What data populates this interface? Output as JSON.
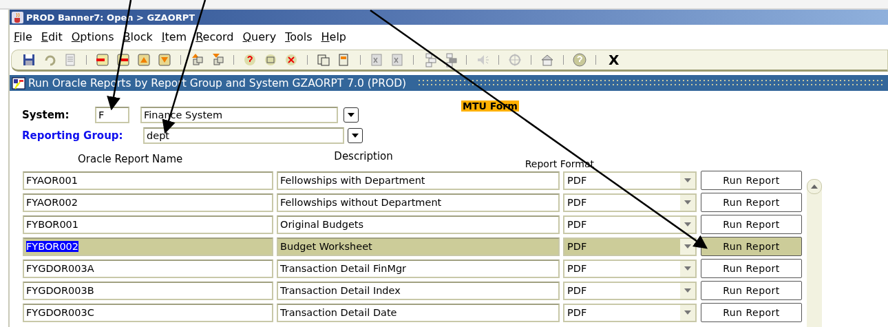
{
  "window": {
    "title": "PROD Banner7:  Open > GZAORPT"
  },
  "menu": [
    "File",
    "Edit",
    "Options",
    "Block",
    "Item",
    "Record",
    "Query",
    "Tools",
    "Help"
  ],
  "toolbar": {
    "exit_label": "X"
  },
  "form": {
    "title": "Run Oracle Reports by Report Group and System  GZAORPT  7.0  (PROD)",
    "badge": "MTU Form",
    "system_label": "System:",
    "system_code": "F",
    "system_name": "Finance System",
    "group_label": "Reporting Group:",
    "group_value": "dept"
  },
  "table": {
    "columns": [
      "Oracle Report Name",
      "Description",
      "Report Format"
    ],
    "rows": [
      {
        "name": "FYAOR001",
        "description": "Fellowships with Department",
        "format": "PDF",
        "action": "Run Report",
        "selected": false
      },
      {
        "name": "FYAOR002",
        "description": "Fellowships without Department",
        "format": "PDF",
        "action": "Run Report",
        "selected": false
      },
      {
        "name": "FYBOR001",
        "description": "Original Budgets",
        "format": "PDF",
        "action": "Run Report",
        "selected": false
      },
      {
        "name": "FYBOR002",
        "description": "Budget Worksheet",
        "format": "PDF",
        "action": "Run Report",
        "selected": true
      },
      {
        "name": "FYGDOR003A",
        "description": "Transaction Detail FinMgr",
        "format": "PDF",
        "action": "Run Report",
        "selected": false
      },
      {
        "name": "FYGDOR003B",
        "description": "Transaction Detail Index",
        "format": "PDF",
        "action": "Run Report",
        "selected": false
      },
      {
        "name": "FYGDOR003C",
        "description": "Transaction Detail Date",
        "format": "PDF",
        "action": "Run Report",
        "selected": false
      }
    ]
  }
}
